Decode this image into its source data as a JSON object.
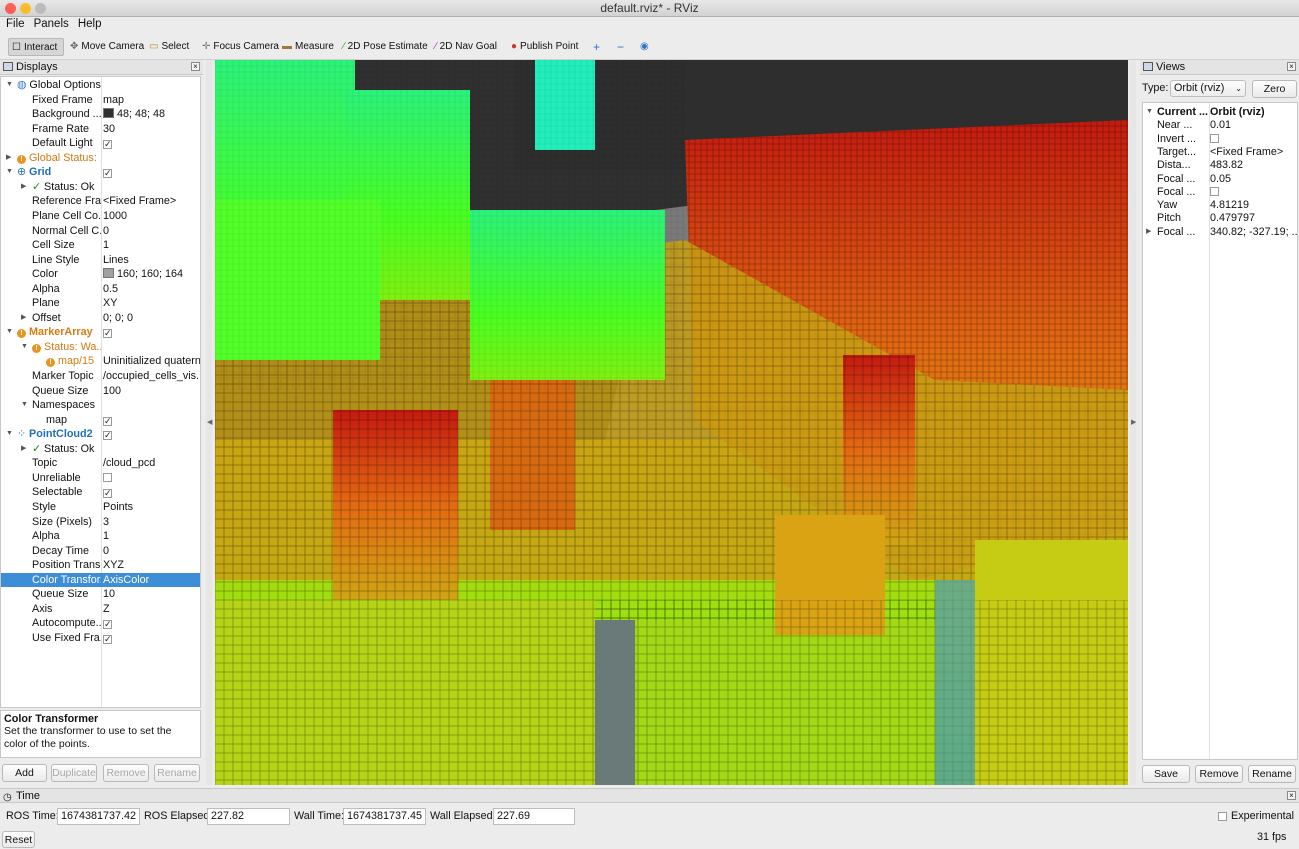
{
  "window": {
    "title": "default.rviz* - RViz"
  },
  "menu": [
    "File",
    "Panels",
    "Help"
  ],
  "toolbar": {
    "items": [
      {
        "label": "Interact",
        "icon": "interact-icon"
      },
      {
        "label": "Move Camera",
        "icon": "move-camera-icon"
      },
      {
        "label": "Select",
        "icon": "select-icon"
      },
      {
        "label": "Focus Camera",
        "icon": "focus-camera-icon"
      },
      {
        "label": "Measure",
        "icon": "measure-icon"
      },
      {
        "label": "2D Pose Estimate",
        "icon": "pose-estimate-icon"
      },
      {
        "label": "2D Nav Goal",
        "icon": "nav-goal-icon"
      },
      {
        "label": "Publish Point",
        "icon": "publish-point-icon"
      }
    ]
  },
  "displays": {
    "title": "Displays",
    "rows": [
      {
        "name": "Global Options",
        "val": ""
      },
      {
        "name": "Fixed Frame",
        "val": "map"
      },
      {
        "name": "Background ...",
        "val": "48; 48; 48"
      },
      {
        "name": "Frame Rate",
        "val": "30"
      },
      {
        "name": "Default Light",
        "val": ""
      },
      {
        "name": "Global Status: ...",
        "val": ""
      },
      {
        "name": "Grid",
        "val": ""
      },
      {
        "name": "Status: Ok",
        "val": ""
      },
      {
        "name": "Reference Fra...",
        "val": "<Fixed Frame>"
      },
      {
        "name": "Plane Cell Co...",
        "val": "1000"
      },
      {
        "name": "Normal Cell C...",
        "val": "0"
      },
      {
        "name": "Cell Size",
        "val": "1"
      },
      {
        "name": "Line Style",
        "val": "Lines"
      },
      {
        "name": "Color",
        "val": "160; 160; 164"
      },
      {
        "name": "Alpha",
        "val": "0.5"
      },
      {
        "name": "Plane",
        "val": "XY"
      },
      {
        "name": "Offset",
        "val": "0; 0; 0"
      },
      {
        "name": "MarkerArray",
        "val": ""
      },
      {
        "name": "Status: Wa...",
        "val": ""
      },
      {
        "name": "map/15",
        "val": "Uninitialized quatern..."
      },
      {
        "name": "Marker Topic",
        "val": "/occupied_cells_vis..."
      },
      {
        "name": "Queue Size",
        "val": "100"
      },
      {
        "name": "Namespaces",
        "val": ""
      },
      {
        "name": "map",
        "val": ""
      },
      {
        "name": "PointCloud2",
        "val": ""
      },
      {
        "name": "Status: Ok",
        "val": ""
      },
      {
        "name": "Topic",
        "val": "/cloud_pcd"
      },
      {
        "name": "Unreliable",
        "val": ""
      },
      {
        "name": "Selectable",
        "val": ""
      },
      {
        "name": "Style",
        "val": "Points"
      },
      {
        "name": "Size (Pixels)",
        "val": "3"
      },
      {
        "name": "Alpha",
        "val": "1"
      },
      {
        "name": "Decay Time",
        "val": "0"
      },
      {
        "name": "Position Trans...",
        "val": "XYZ"
      },
      {
        "name": "Color Transfor...",
        "val": "AxisColor"
      },
      {
        "name": "Queue Size",
        "val": "10"
      },
      {
        "name": "Axis",
        "val": "Z"
      },
      {
        "name": "Autocompute...",
        "val": ""
      },
      {
        "name": "Use Fixed Fra...",
        "val": ""
      }
    ],
    "help_title": "Color Transformer",
    "help_text": "Set the transformer to use to set the color of the points.",
    "buttons": [
      "Add",
      "Duplicate",
      "Remove",
      "Rename"
    ]
  },
  "views": {
    "title": "Views",
    "type_label": "Type:",
    "type_value": "Orbit (rviz)",
    "zero": "Zero",
    "rows": [
      {
        "name": "Current ...",
        "val": "Orbit (rviz)"
      },
      {
        "name": "Near ...",
        "val": "0.01"
      },
      {
        "name": "Invert ...",
        "val": ""
      },
      {
        "name": "Target...",
        "val": "<Fixed Frame>"
      },
      {
        "name": "Dista...",
        "val": "483.82"
      },
      {
        "name": "Focal ...",
        "val": "0.05"
      },
      {
        "name": "Focal ...",
        "val": ""
      },
      {
        "name": "Yaw",
        "val": "4.81219"
      },
      {
        "name": "Pitch",
        "val": "0.479797"
      },
      {
        "name": "Focal ...",
        "val": "340.82; -327.19; ..."
      }
    ],
    "buttons": [
      "Save",
      "Remove",
      "Rename"
    ]
  },
  "time": {
    "title": "Time",
    "ros_time_label": "ROS Time:",
    "ros_time": "1674381737.42",
    "ros_elapsed_label": "ROS Elapsed:",
    "ros_elapsed": "227.82",
    "wall_time_label": "Wall Time:",
    "wall_time": "1674381737.45",
    "wall_elapsed_label": "Wall Elapsed:",
    "wall_elapsed": "227.69",
    "experimental": "Experimental",
    "reset": "Reset",
    "fps": "31 fps"
  },
  "colors": {
    "background": "#303030",
    "grid": "#a0a0a4",
    "selection": "#3d8ed6"
  }
}
